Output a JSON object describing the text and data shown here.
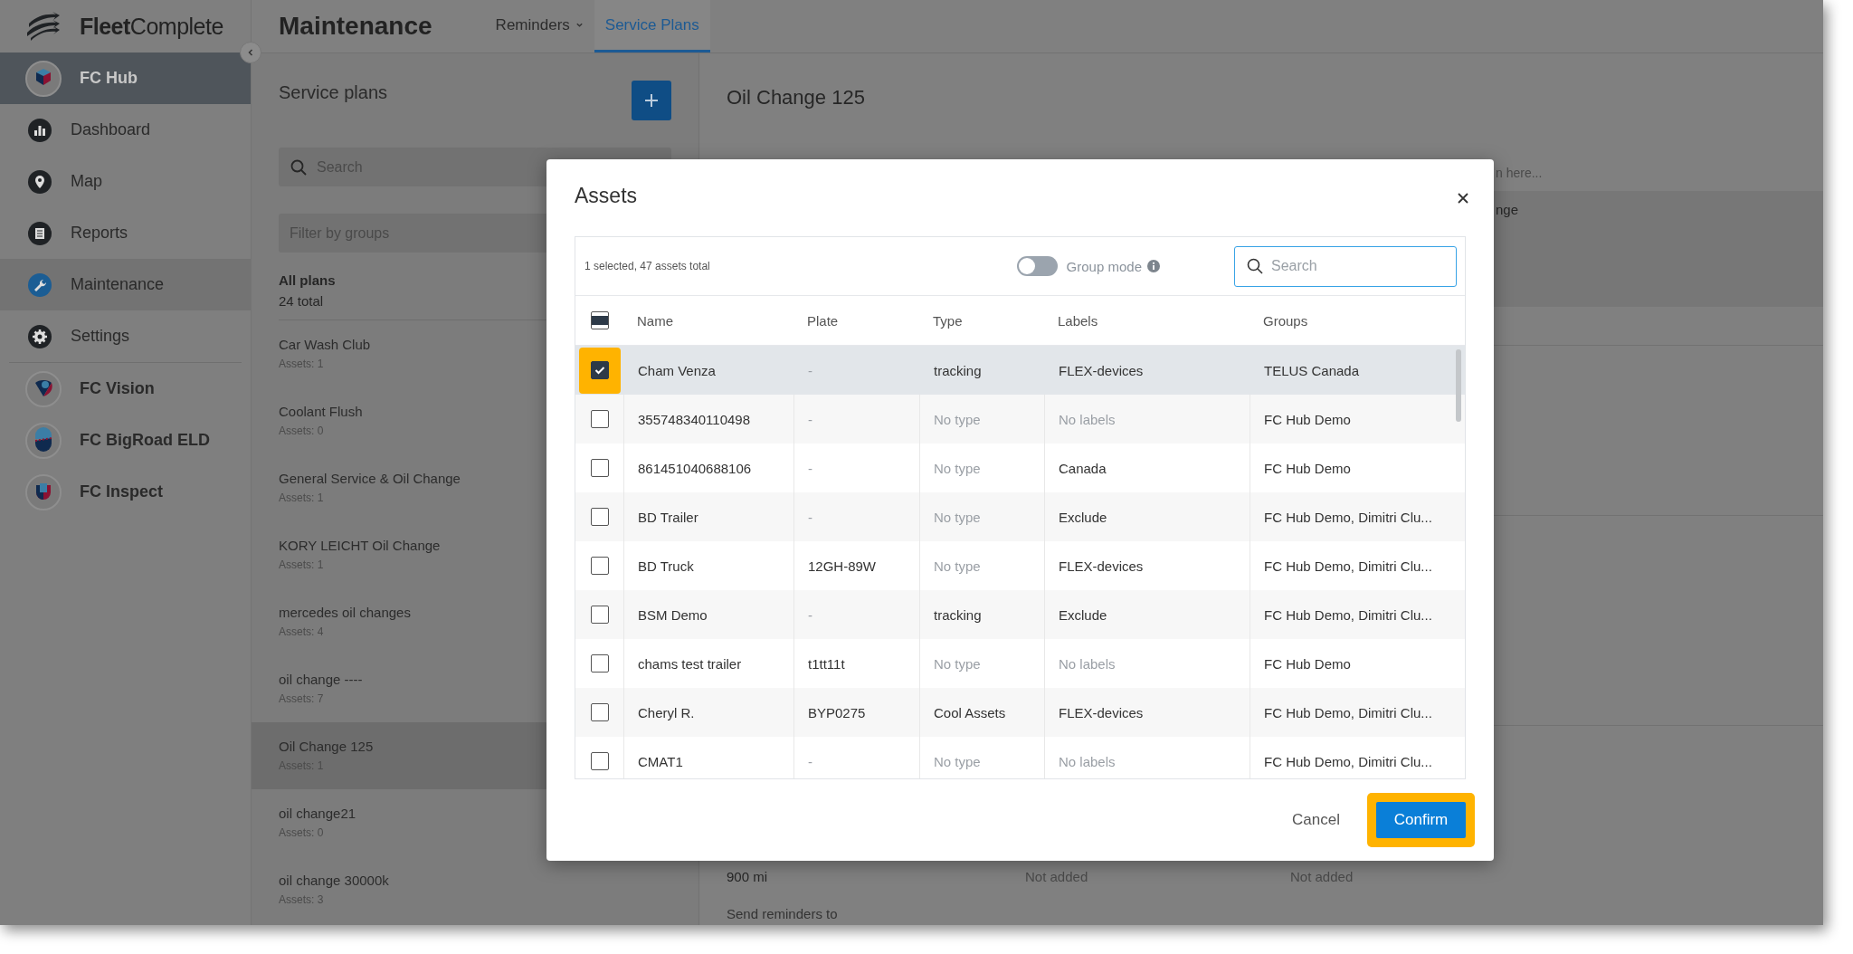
{
  "sidebar": {
    "logo": "**Fleet**Complete",
    "items": [
      {
        "label": "FC Hub",
        "kind": "app",
        "selected": true
      },
      {
        "label": "Dashboard",
        "kind": "page",
        "selected": false
      },
      {
        "label": "Map",
        "kind": "page",
        "selected": false
      },
      {
        "label": "Reports",
        "kind": "page",
        "selected": false
      },
      {
        "label": "Maintenance",
        "kind": "page",
        "selected": true
      },
      {
        "label": "Settings",
        "kind": "page",
        "selected": false
      },
      {
        "label": "FC Vision",
        "kind": "app",
        "selected": false
      },
      {
        "label": "FC BigRoad ELD",
        "kind": "app",
        "selected": false
      },
      {
        "label": "FC Inspect",
        "kind": "app",
        "selected": false
      }
    ]
  },
  "header": {
    "title": "Maintenance",
    "tabs": [
      {
        "label": "Reminders",
        "dropdown": true,
        "selected": false
      },
      {
        "label": "Service Plans",
        "dropdown": false,
        "selected": true
      }
    ]
  },
  "service_plans": {
    "title": "Service plans",
    "search": {
      "placeholder": "Search"
    },
    "group_filter": {
      "placeholder": "Filter by groups"
    },
    "summary": {
      "title": "All plans",
      "count": "24 total"
    },
    "plans": [
      {
        "name": "Car Wash Club",
        "assets": "Assets: 1",
        "selected": false
      },
      {
        "name": "Coolant Flush",
        "assets": "Assets: 0",
        "selected": false
      },
      {
        "name": "General Service & Oil Change",
        "assets": "Assets: 1",
        "selected": false
      },
      {
        "name": "KORY LEICHT Oil Change",
        "assets": "Assets: 1",
        "selected": false
      },
      {
        "name": "mercedes oil changes",
        "assets": "Assets: 4",
        "selected": false
      },
      {
        "name": "oil change ----",
        "assets": "Assets: 7",
        "selected": false
      },
      {
        "name": "Oil Change 125",
        "assets": "Assets: 1",
        "selected": true
      },
      {
        "name": "oil change21",
        "assets": "Assets: 0",
        "selected": false
      },
      {
        "name": "oil change 30000k",
        "assets": "Assets: 3",
        "selected": false
      }
    ]
  },
  "detail": {
    "title": "Oil Change 125",
    "hint": "n here...",
    "band_text": "nge",
    "interval": "900 mi",
    "values": [
      "Not added",
      "Not added"
    ],
    "section": "Send reminders to"
  },
  "modal": {
    "title": "Assets",
    "summary": "1 selected, 47 assets total",
    "group_mode": {
      "label": "Group mode",
      "on": false
    },
    "search": {
      "placeholder": "Search"
    },
    "select_all": {
      "checked": false,
      "indeterminate": true
    },
    "columns": [
      "Name",
      "Plate",
      "Type",
      "Labels",
      "Groups"
    ],
    "rows": [
      {
        "name": "Cham Venza",
        "plate": "-",
        "type": "tracking",
        "labels": "FLEX-devices",
        "groups": "TELUS Canada",
        "checked": true,
        "selected": true,
        "highlighted": true,
        "plate_muted": true,
        "type_muted": false,
        "labels_muted": false
      },
      {
        "name": "355748340110498",
        "plate": "-",
        "type": "No type",
        "labels": "No labels",
        "groups": "FC Hub Demo",
        "checked": false,
        "selected": false,
        "highlighted": false,
        "plate_muted": true,
        "type_muted": true,
        "labels_muted": true
      },
      {
        "name": "861451040688106",
        "plate": "-",
        "type": "No type",
        "labels": "Canada",
        "groups": "FC Hub Demo",
        "checked": false,
        "selected": false,
        "highlighted": false,
        "plate_muted": true,
        "type_muted": true,
        "labels_muted": false
      },
      {
        "name": "BD Trailer",
        "plate": "-",
        "type": "No type",
        "labels": "Exclude",
        "groups": "FC Hub Demo, Dimitri Clu...",
        "checked": false,
        "selected": false,
        "highlighted": false,
        "plate_muted": true,
        "type_muted": true,
        "labels_muted": false
      },
      {
        "name": "BD Truck",
        "plate": "12GH-89W",
        "type": "No type",
        "labels": "FLEX-devices",
        "groups": "FC Hub Demo, Dimitri Clu...",
        "checked": false,
        "selected": false,
        "highlighted": false,
        "plate_muted": false,
        "type_muted": true,
        "labels_muted": false
      },
      {
        "name": "BSM Demo",
        "plate": "-",
        "type": "tracking",
        "labels": "Exclude",
        "groups": "FC Hub Demo, Dimitri Clu...",
        "checked": false,
        "selected": false,
        "highlighted": false,
        "plate_muted": true,
        "type_muted": false,
        "labels_muted": false
      },
      {
        "name": "chams test trailer",
        "plate": "t1tt11t",
        "type": "No type",
        "labels": "No labels",
        "groups": "FC Hub Demo",
        "checked": false,
        "selected": false,
        "highlighted": false,
        "plate_muted": false,
        "type_muted": true,
        "labels_muted": true
      },
      {
        "name": "Cheryl R.",
        "plate": "BYP0275",
        "type": "Cool Assets",
        "labels": "FLEX-devices",
        "groups": "FC Hub Demo, Dimitri Clu...",
        "checked": false,
        "selected": false,
        "highlighted": false,
        "plate_muted": false,
        "type_muted": false,
        "labels_muted": false
      },
      {
        "name": "CMAT1",
        "plate": "-",
        "type": "No type",
        "labels": "No labels",
        "groups": "FC Hub Demo, Dimitri Clu...",
        "checked": false,
        "selected": false,
        "highlighted": false,
        "plate_muted": true,
        "type_muted": true,
        "labels_muted": true
      }
    ],
    "buttons": [
      {
        "label": "Cancel",
        "kind": "secondary",
        "highlighted": false
      },
      {
        "label": "Confirm",
        "kind": "primary",
        "highlighted": true
      }
    ]
  }
}
